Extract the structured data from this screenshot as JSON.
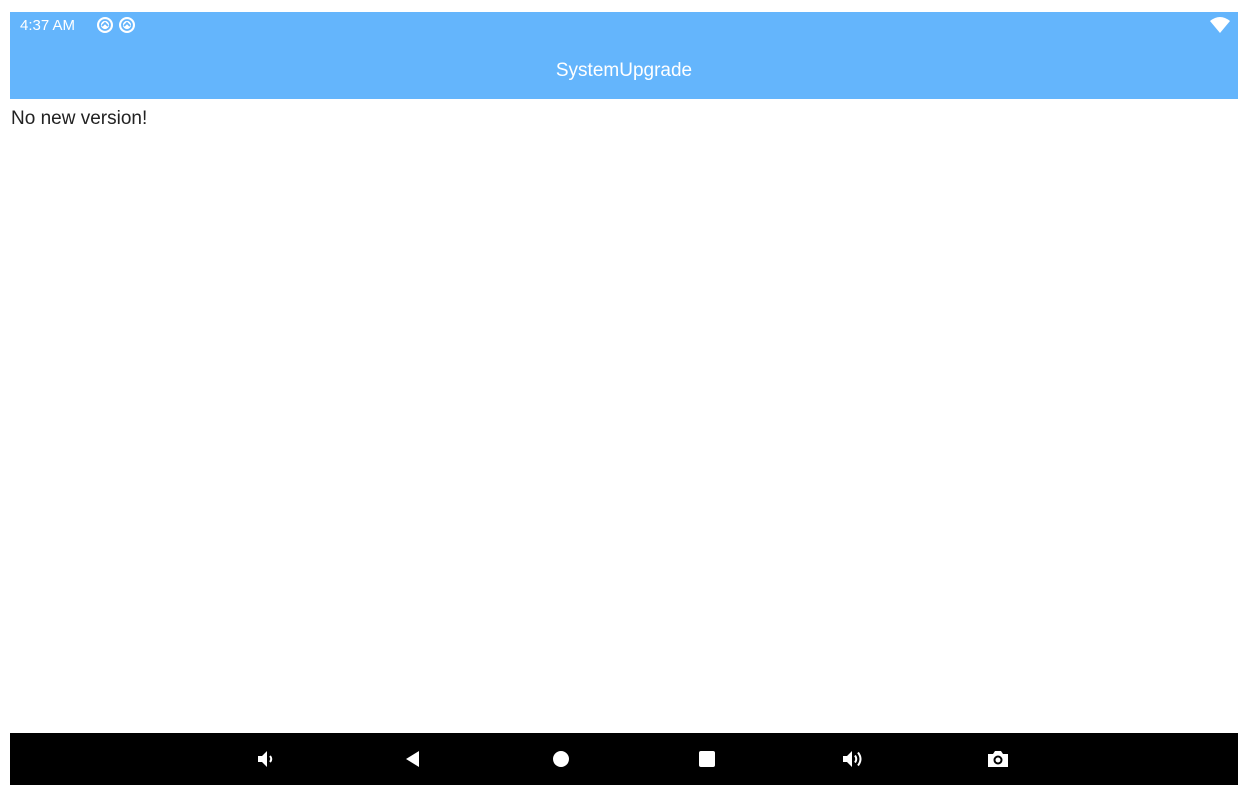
{
  "status_bar": {
    "time": "4:37 AM",
    "notification_icons": [
      "notification-icon",
      "notification-icon"
    ],
    "right_icons": [
      "wifi-icon"
    ]
  },
  "app_bar": {
    "title": "SystemUpgrade"
  },
  "content": {
    "message": "No new version!"
  },
  "nav_bar": {
    "buttons": [
      "volume-down-icon",
      "back-icon",
      "home-icon",
      "recents-icon",
      "volume-up-icon",
      "screenshot-icon"
    ]
  },
  "colors": {
    "app_bar": "#64b5fc",
    "nav_bar": "#000000",
    "background": "#ffffff"
  }
}
